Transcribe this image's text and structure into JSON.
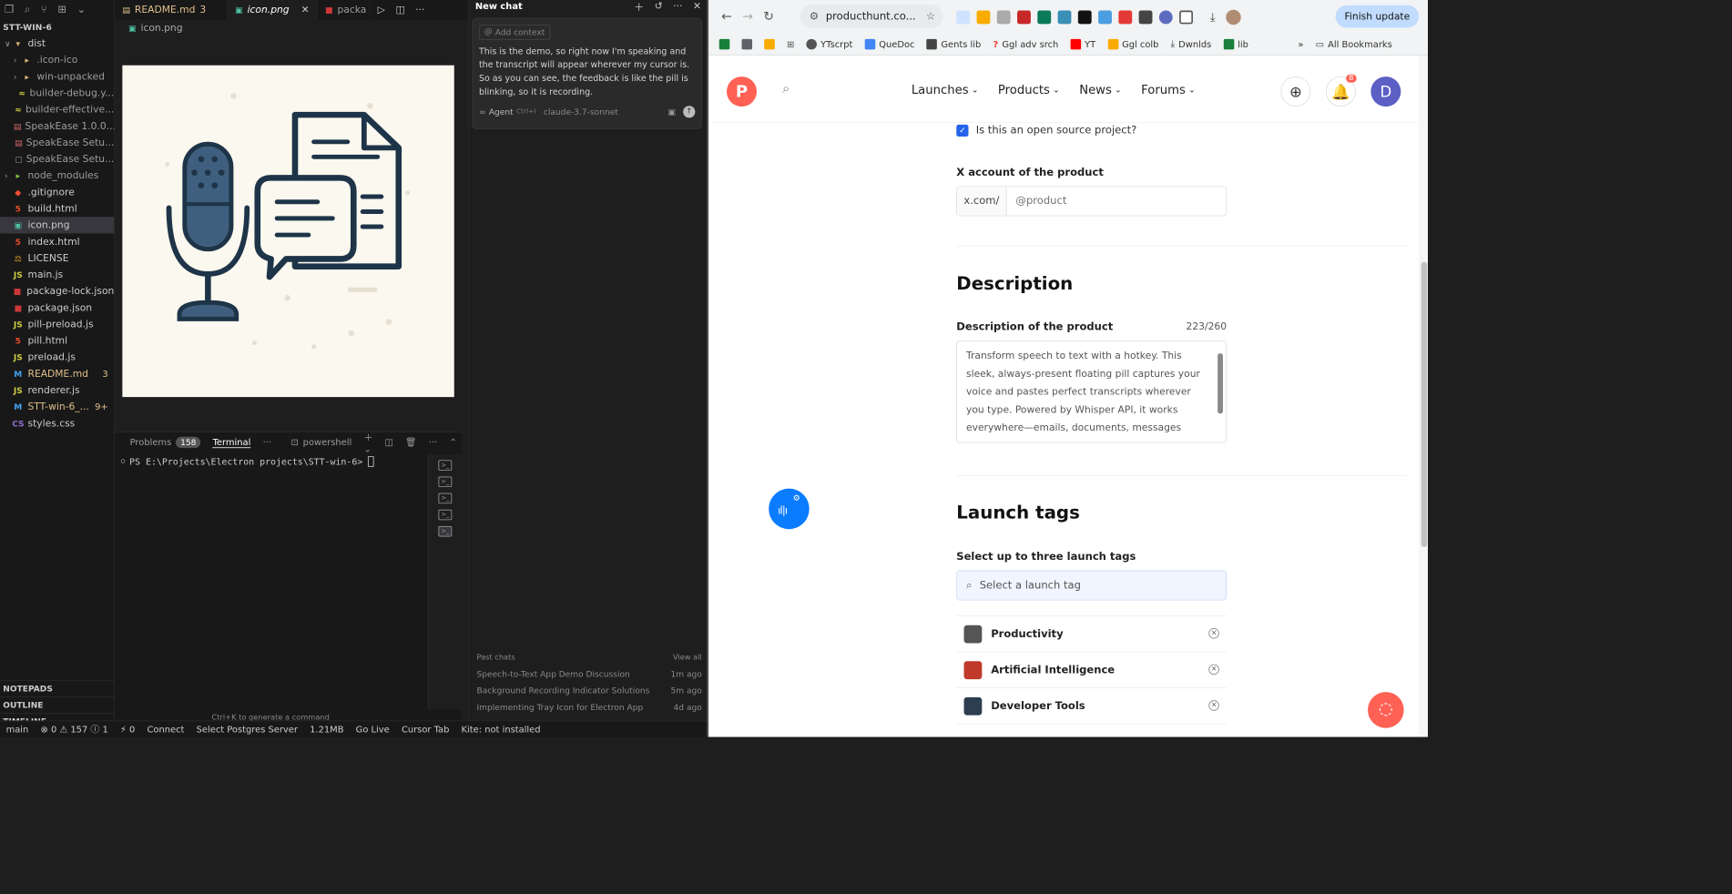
{
  "vscode": {
    "explorer_title": "STT-WIN-6",
    "tree": [
      {
        "label": "dist",
        "icon": "folder-open-icon",
        "level": 0,
        "arrow": "∨",
        "color": "#ccc"
      },
      {
        "label": ".icon-ico",
        "icon": "folder-icon",
        "level": 1,
        "arrow": "›",
        "color": "#9d9d9d"
      },
      {
        "label": "win-unpacked",
        "icon": "folder-icon",
        "level": 1,
        "arrow": "›",
        "color": "#9d9d9d"
      },
      {
        "label": "builder-debug.y...",
        "icon": "yaml-icon",
        "level": 1,
        "arrow": "",
        "color": "#9d9d9d"
      },
      {
        "label": "builder-effective...",
        "icon": "yaml-icon",
        "level": 1,
        "arrow": "",
        "color": "#9d9d9d"
      },
      {
        "label": "SpeakEase 1.0.0....",
        "icon": "exe-icon",
        "level": 1,
        "arrow": "",
        "color": "#9d9d9d"
      },
      {
        "label": "SpeakEase Setu...",
        "icon": "exe-icon",
        "level": 1,
        "arrow": "",
        "color": "#9d9d9d"
      },
      {
        "label": "SpeakEase Setu...",
        "icon": "file-icon",
        "level": 1,
        "arrow": "",
        "color": "#9d9d9d"
      },
      {
        "label": "node_modules",
        "icon": "folder-node-icon",
        "level": 0,
        "arrow": "›",
        "color": "#9d9d9d"
      },
      {
        "label": ".gitignore",
        "icon": "git-icon",
        "level": 0,
        "arrow": "",
        "color": "#ccc"
      },
      {
        "label": "build.html",
        "icon": "html-icon",
        "level": 0,
        "arrow": "",
        "color": "#ccc"
      },
      {
        "label": "icon.png",
        "icon": "image-icon",
        "level": 0,
        "arrow": "",
        "color": "#ccc",
        "selected": true
      },
      {
        "label": "index.html",
        "icon": "html-icon",
        "level": 0,
        "arrow": "",
        "color": "#ccc"
      },
      {
        "label": "LICENSE",
        "icon": "license-icon",
        "level": 0,
        "arrow": "",
        "color": "#ccc"
      },
      {
        "label": "main.js",
        "icon": "js-icon",
        "level": 0,
        "arrow": "",
        "color": "#ccc"
      },
      {
        "label": "package-lock.json",
        "icon": "npm-icon",
        "level": 0,
        "arrow": "",
        "color": "#ccc"
      },
      {
        "label": "package.json",
        "icon": "npm-icon",
        "level": 0,
        "arrow": "",
        "color": "#ccc"
      },
      {
        "label": "pill-preload.js",
        "icon": "js-icon",
        "level": 0,
        "arrow": "",
        "color": "#ccc"
      },
      {
        "label": "pill.html",
        "icon": "html-icon",
        "level": 0,
        "arrow": "",
        "color": "#ccc"
      },
      {
        "label": "preload.js",
        "icon": "js-icon",
        "level": 0,
        "arrow": "",
        "color": "#ccc"
      },
      {
        "label": "README.md",
        "icon": "markdown-icon",
        "level": 0,
        "arrow": "",
        "color": "#e2c08d",
        "badge": "3"
      },
      {
        "label": "renderer.js",
        "icon": "js-icon",
        "level": 0,
        "arrow": "",
        "color": "#ccc"
      },
      {
        "label": "STT-win-6_...",
        "icon": "markdown-icon",
        "level": 0,
        "arrow": "",
        "color": "#e2c08d",
        "badge": "9+"
      },
      {
        "label": "styles.css",
        "icon": "css-icon",
        "level": 0,
        "arrow": "",
        "color": "#ccc"
      }
    ],
    "sidebar_sections": [
      "NOTEPADS",
      "OUTLINE",
      "TIMELINE"
    ],
    "tabs": [
      {
        "label": "README.md",
        "badge": "3",
        "active": false
      },
      {
        "label": "icon.png",
        "badge": "",
        "active": true
      },
      {
        "label": "packa",
        "badge": "",
        "active": false
      }
    ],
    "breadcrumb": "icon.png",
    "panel": {
      "problems_label": "Problems",
      "problems_count": "158",
      "terminal_label": "Terminal",
      "shell": "powershell",
      "prompt": "PS E:\\Projects\\Electron projects\\STT-win-6> ",
      "hint": "Ctrl+K to generate a command"
    },
    "status": [
      "main",
      "⊗ 0 ⚠ 157 ⓘ 1",
      "⚡ 0",
      "Connect",
      "Select Postgres Server",
      "1.21MB",
      "Go Live",
      "Cursor Tab",
      "Kite: not installed"
    ]
  },
  "chat": {
    "title": "New chat",
    "add_context": "Add context",
    "message": "This is the demo, so right now I'm speaking and the transcript will appear wherever my cursor is. So as you can see, the feedback is like the pill is blinking, so it is recording.",
    "agent_label": "Agent",
    "agent_shortcut": "Ctrl+I",
    "model": "claude-3.7-sonnet",
    "past_chats_label": "Past chats",
    "view_all": "View all",
    "past_chats": [
      {
        "title": "Speech-to-Text App Demo Discussion",
        "time": "1m ago"
      },
      {
        "title": "Background Recording Indicator Solutions",
        "time": "5m ago"
      },
      {
        "title": "Implementing Tray Icon for Electron App",
        "time": "4d ago"
      }
    ]
  },
  "chrome": {
    "url": "producthunt.co...",
    "finish_update": "Finish update",
    "bookmarks": [
      {
        "label": "YTscrpt",
        "color": "#555"
      },
      {
        "label": "QueDoc",
        "color": "#4285f4"
      },
      {
        "label": "Gents lib",
        "color": "#444"
      },
      {
        "label": "Ggl adv srch",
        "color": "#ea4335"
      },
      {
        "label": "YT",
        "color": "#ff0000"
      },
      {
        "label": "Ggl colb",
        "color": "#f9ab00"
      },
      {
        "label": "Dwnlds",
        "color": "#555"
      },
      {
        "label": "lib",
        "color": "#188038"
      }
    ],
    "all_bookmarks": "All Bookmarks"
  },
  "producthunt": {
    "logo": "P",
    "nav": [
      "Launches",
      "Products",
      "News",
      "Forums"
    ],
    "notif_count": "8",
    "avatar": "D",
    "open_source_label": "Is this an open source project?",
    "x_account_label": "X account of the product",
    "x_prefix": "x.com/",
    "x_placeholder": "@product",
    "description_heading": "Description",
    "description_label": "Description of the product",
    "description_count": "223/260",
    "description_text": "Transform speech to text with a hotkey. This sleek, always-present floating pill captures your voice and pastes perfect transcripts wherever you type. Powered by Whisper API, it works everywhere—emails, documents, messages",
    "tags_heading": "Launch tags",
    "tags_label": "Select up to three launch tags",
    "tags_placeholder": "Select a launch tag",
    "tags": [
      {
        "label": "Productivity",
        "color": "#555"
      },
      {
        "label": "Artificial Intelligence",
        "color": "#c0392b"
      },
      {
        "label": "Developer Tools",
        "color": "#2c3e50"
      }
    ]
  },
  "colors": {
    "accent": "#ff6154",
    "pill": "#0a7cff",
    "chrome_accent": "#c2dcff"
  }
}
